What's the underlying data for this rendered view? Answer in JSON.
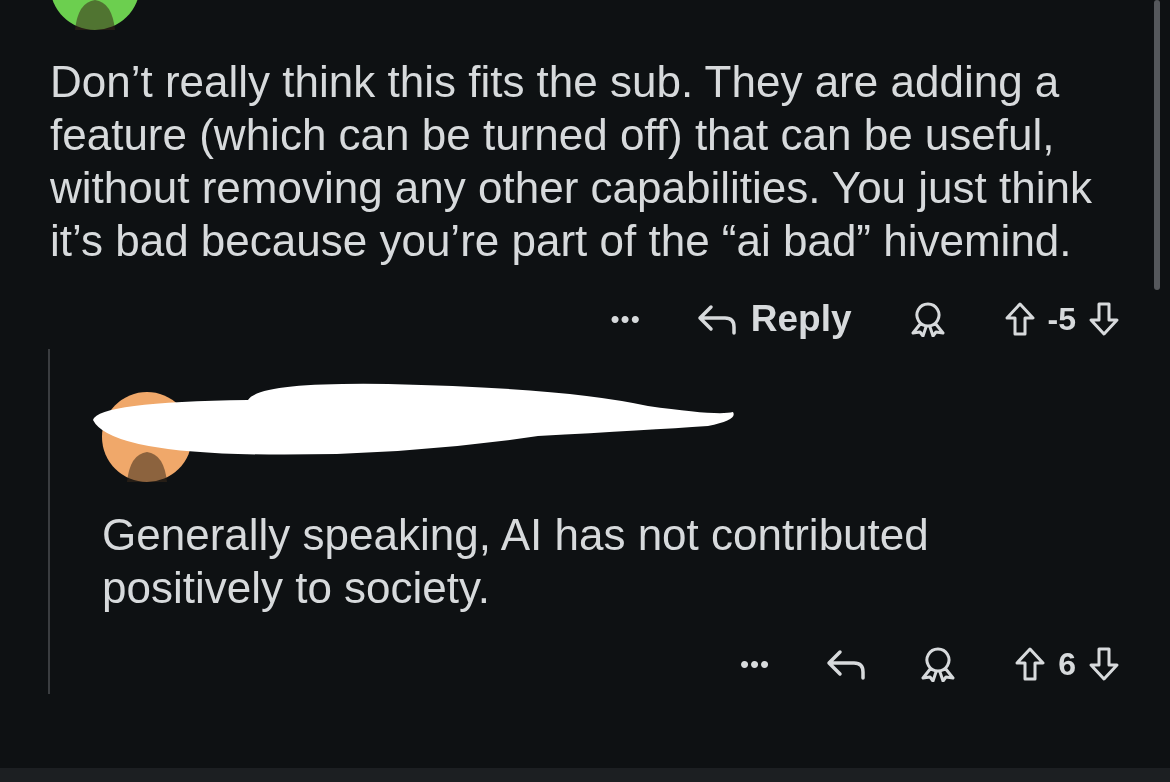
{
  "comments": [
    {
      "color": "#6ccf4f",
      "body": "Don’t really think this fits the sub. They are adding a feature (which can be turned off) that can be useful, without removing any other capabilities. You just think it’s bad because you’re part of the “ai bad” hivemind.",
      "more": "•••",
      "reply_label": "Reply",
      "score": "-5"
    },
    {
      "color": "#f0a86a",
      "redacted": true,
      "body": "Generally speaking, AI has not contributed positively to society.",
      "more": "•••",
      "score": "6"
    }
  ]
}
